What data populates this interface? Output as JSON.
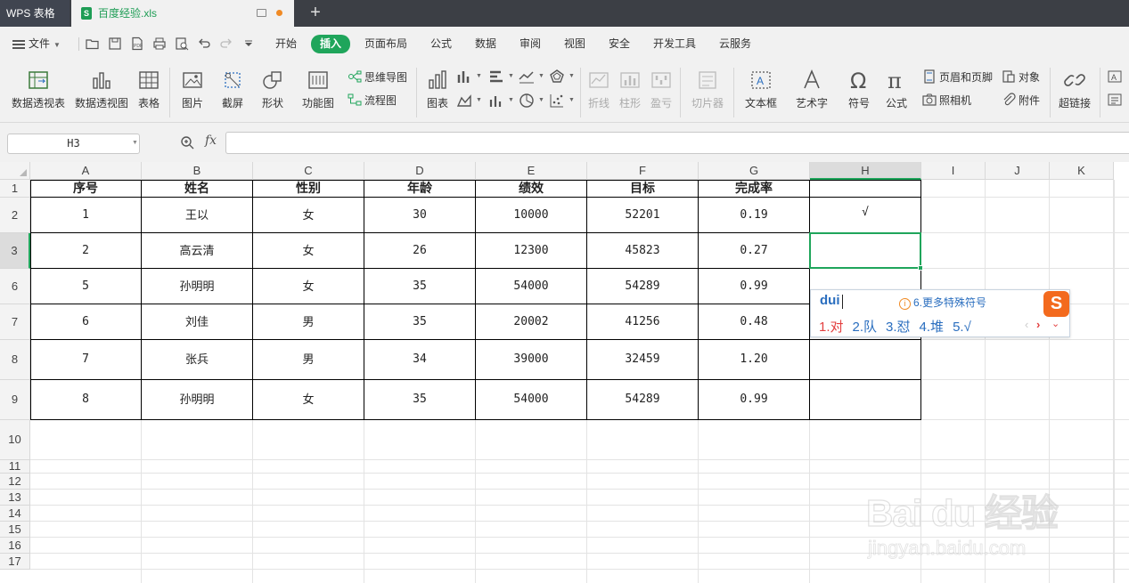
{
  "titlebar": {
    "app_name": "WPS 表格",
    "doc_name": "百度经验.xls",
    "new_tab": "+"
  },
  "menubar": {
    "file_label": "文件",
    "items": [
      "开始",
      "插入",
      "页面布局",
      "公式",
      "数据",
      "审阅",
      "视图",
      "安全",
      "开发工具",
      "云服务"
    ],
    "active": "插入"
  },
  "ribbon": {
    "pivot_table": "数据透视表",
    "pivot_chart": "数据透视图",
    "table": "表格",
    "picture": "图片",
    "screenshot": "截屏",
    "shapes": "形状",
    "function_chart": "功能图",
    "mind_map": "思维导图",
    "flowchart": "流程图",
    "chart": "图表",
    "sparkline_line": "折线",
    "sparkline_column": "柱形",
    "sparkline_winloss": "盈亏",
    "slicer": "切片器",
    "textbox": "文本框",
    "wordart": "艺术字",
    "symbol": "符号",
    "formula": "公式",
    "header_footer": "页眉和页脚",
    "camera": "照相机",
    "object": "对象",
    "attachment": "附件",
    "hyperlink": "超链接"
  },
  "formulabar": {
    "cell_ref": "H3",
    "fx": "fx",
    "value": ""
  },
  "sheet": {
    "columns": [
      "A",
      "B",
      "C",
      "D",
      "E",
      "F",
      "G",
      "H",
      "I",
      "J",
      "K"
    ],
    "selected_column": "H",
    "row_numbers": [
      "1",
      "2",
      "3",
      "6",
      "7",
      "8",
      "9",
      "10",
      "11",
      "12",
      "13",
      "14",
      "15",
      "16",
      "17"
    ],
    "selected_row": "3",
    "headers": [
      "序号",
      "姓名",
      "性别",
      "年龄",
      "绩效",
      "目标",
      "完成率",
      ""
    ],
    "rows": [
      [
        "1",
        "王以",
        "女",
        "30",
        "10000",
        "52201",
        "0.19",
        "√"
      ],
      [
        "2",
        "高云清",
        "女",
        "26",
        "12300",
        "45823",
        "0.27",
        ""
      ],
      [
        "5",
        "孙明明",
        "女",
        "35",
        "54000",
        "54289",
        "0.99",
        ""
      ],
      [
        "6",
        "刘佳",
        "男",
        "35",
        "20002",
        "41256",
        "0.48",
        ""
      ],
      [
        "7",
        "张兵",
        "男",
        "34",
        "39000",
        "32459",
        "1.20",
        ""
      ],
      [
        "8",
        "孙明明",
        "女",
        "35",
        "54000",
        "54289",
        "0.99",
        ""
      ]
    ]
  },
  "ime": {
    "pinyin": "dui",
    "tip_icon": "i",
    "tip": "6.更多特殊符号",
    "logo": "S",
    "candidates": [
      "1.对",
      "2.队",
      "3.怼",
      "4.堆",
      "5.√"
    ],
    "prev": "‹",
    "next": "›",
    "more": "⌄"
  },
  "watermark": {
    "text": "Bai du 经验",
    "sub": "jingyan.baidu.com"
  },
  "colors": {
    "accent": "#1fa55b",
    "titlebar": "#3c3f45",
    "ribbon_bg": "#f1f1f1"
  }
}
